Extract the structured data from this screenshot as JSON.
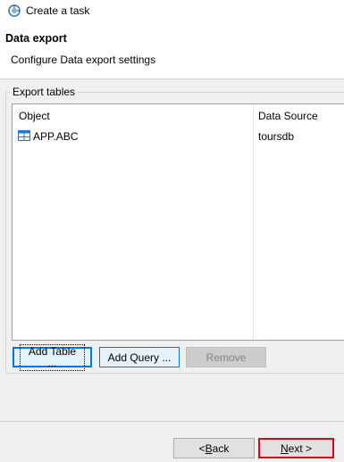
{
  "window": {
    "title": "Create a task",
    "icon": "task-wizard-icon"
  },
  "header": {
    "title": "Data export",
    "description": "Configure Data export settings"
  },
  "export_tables": {
    "group_label": "Export tables",
    "columns": [
      "Object",
      "Data Source"
    ],
    "rows": [
      {
        "object": "APP.ABC",
        "data_source": "toursdb",
        "icon": "table-icon"
      }
    ]
  },
  "buttons": {
    "add_table": "Add Table ...",
    "add_query": "Add Query ...",
    "remove": "Remove",
    "back_mnemonic": "B",
    "back_rest": "ack",
    "back_prefix": "< ",
    "next_mnemonic": "N",
    "next_rest": "ext >"
  },
  "colors": {
    "accent": "#0078d7",
    "highlight_border": "#e2001a",
    "table_icon": "#1e7ad6"
  }
}
